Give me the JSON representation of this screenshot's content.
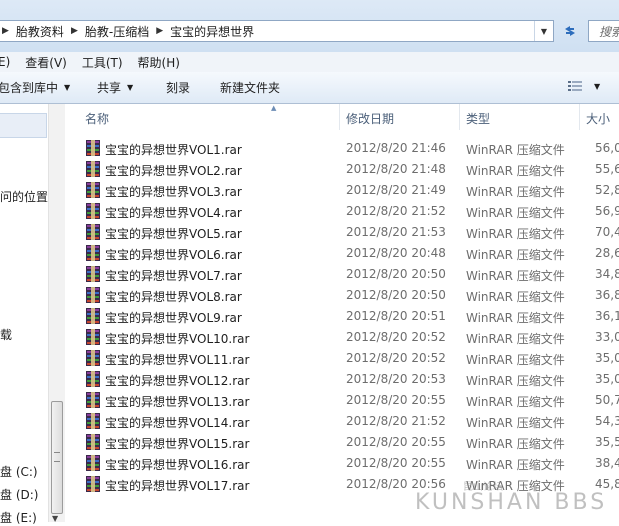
{
  "address": {
    "crumbs": [
      "胎教资料",
      "胎教-压缩档",
      "宝宝的异想世界"
    ],
    "search_placeholder": "搜索"
  },
  "menu": {
    "items": [
      "E)",
      "查看(V)",
      "工具(T)",
      "帮助(H)"
    ]
  },
  "toolbar": {
    "include_library": "包含到库中",
    "share": "共享",
    "burn": "刻录",
    "new_folder": "新建文件夹"
  },
  "nav": {
    "items": [
      "问的位置",
      "载",
      "盘 (C:)",
      "盘 (D:)",
      "盘 (E:)"
    ]
  },
  "columns": {
    "name": "名称",
    "date": "修改日期",
    "type": "类型",
    "size": "大小"
  },
  "files": [
    {
      "name": "宝宝的异想世界VOL1.rar",
      "date": "2012/8/20 21:46",
      "type": "WinRAR 压缩文件",
      "size": "56,0"
    },
    {
      "name": "宝宝的异想世界VOL2.rar",
      "date": "2012/8/20 21:48",
      "type": "WinRAR 压缩文件",
      "size": "55,6"
    },
    {
      "name": "宝宝的异想世界VOL3.rar",
      "date": "2012/8/20 21:49",
      "type": "WinRAR 压缩文件",
      "size": "52,8"
    },
    {
      "name": "宝宝的异想世界VOL4.rar",
      "date": "2012/8/20 21:52",
      "type": "WinRAR 压缩文件",
      "size": "56,9"
    },
    {
      "name": "宝宝的异想世界VOL5.rar",
      "date": "2012/8/20 21:53",
      "type": "WinRAR 压缩文件",
      "size": "70,4"
    },
    {
      "name": "宝宝的异想世界VOL6.rar",
      "date": "2012/8/20 20:48",
      "type": "WinRAR 压缩文件",
      "size": "28,6"
    },
    {
      "name": "宝宝的异想世界VOL7.rar",
      "date": "2012/8/20 20:50",
      "type": "WinRAR 压缩文件",
      "size": "34,8"
    },
    {
      "name": "宝宝的异想世界VOL8.rar",
      "date": "2012/8/20 20:50",
      "type": "WinRAR 压缩文件",
      "size": "36,8"
    },
    {
      "name": "宝宝的异想世界VOL9.rar",
      "date": "2012/8/20 20:51",
      "type": "WinRAR 压缩文件",
      "size": "36,1"
    },
    {
      "name": "宝宝的异想世界VOL10.rar",
      "date": "2012/8/20 20:52",
      "type": "WinRAR 压缩文件",
      "size": "33,0"
    },
    {
      "name": "宝宝的异想世界VOL11.rar",
      "date": "2012/8/20 20:52",
      "type": "WinRAR 压缩文件",
      "size": "35,0"
    },
    {
      "name": "宝宝的异想世界VOL12.rar",
      "date": "2012/8/20 20:53",
      "type": "WinRAR 压缩文件",
      "size": "35,0"
    },
    {
      "name": "宝宝的异想世界VOL13.rar",
      "date": "2012/8/20 20:55",
      "type": "WinRAR 压缩文件",
      "size": "50,7"
    },
    {
      "name": "宝宝的异想世界VOL14.rar",
      "date": "2012/8/20 21:52",
      "type": "WinRAR 压缩文件",
      "size": "54,3"
    },
    {
      "name": "宝宝的异想世界VOL15.rar",
      "date": "2012/8/20 20:55",
      "type": "WinRAR 压缩文件",
      "size": "35,5"
    },
    {
      "name": "宝宝的异想世界VOL16.rar",
      "date": "2012/8/20 20:55",
      "type": "WinRAR 压缩文件",
      "size": "38,4"
    },
    {
      "name": "宝宝的异想世界VOL17.rar",
      "date": "2012/8/20 20:56",
      "type": "WinRAR 压缩文件",
      "size": "45,8"
    }
  ],
  "watermark": {
    "small": "昆山论坛",
    "big": "KUNSHAN BBS"
  },
  "colors": {
    "header_text": "#4c607a",
    "meta_text": "#6d6d6d",
    "chrome_top": "#dde9f6"
  }
}
